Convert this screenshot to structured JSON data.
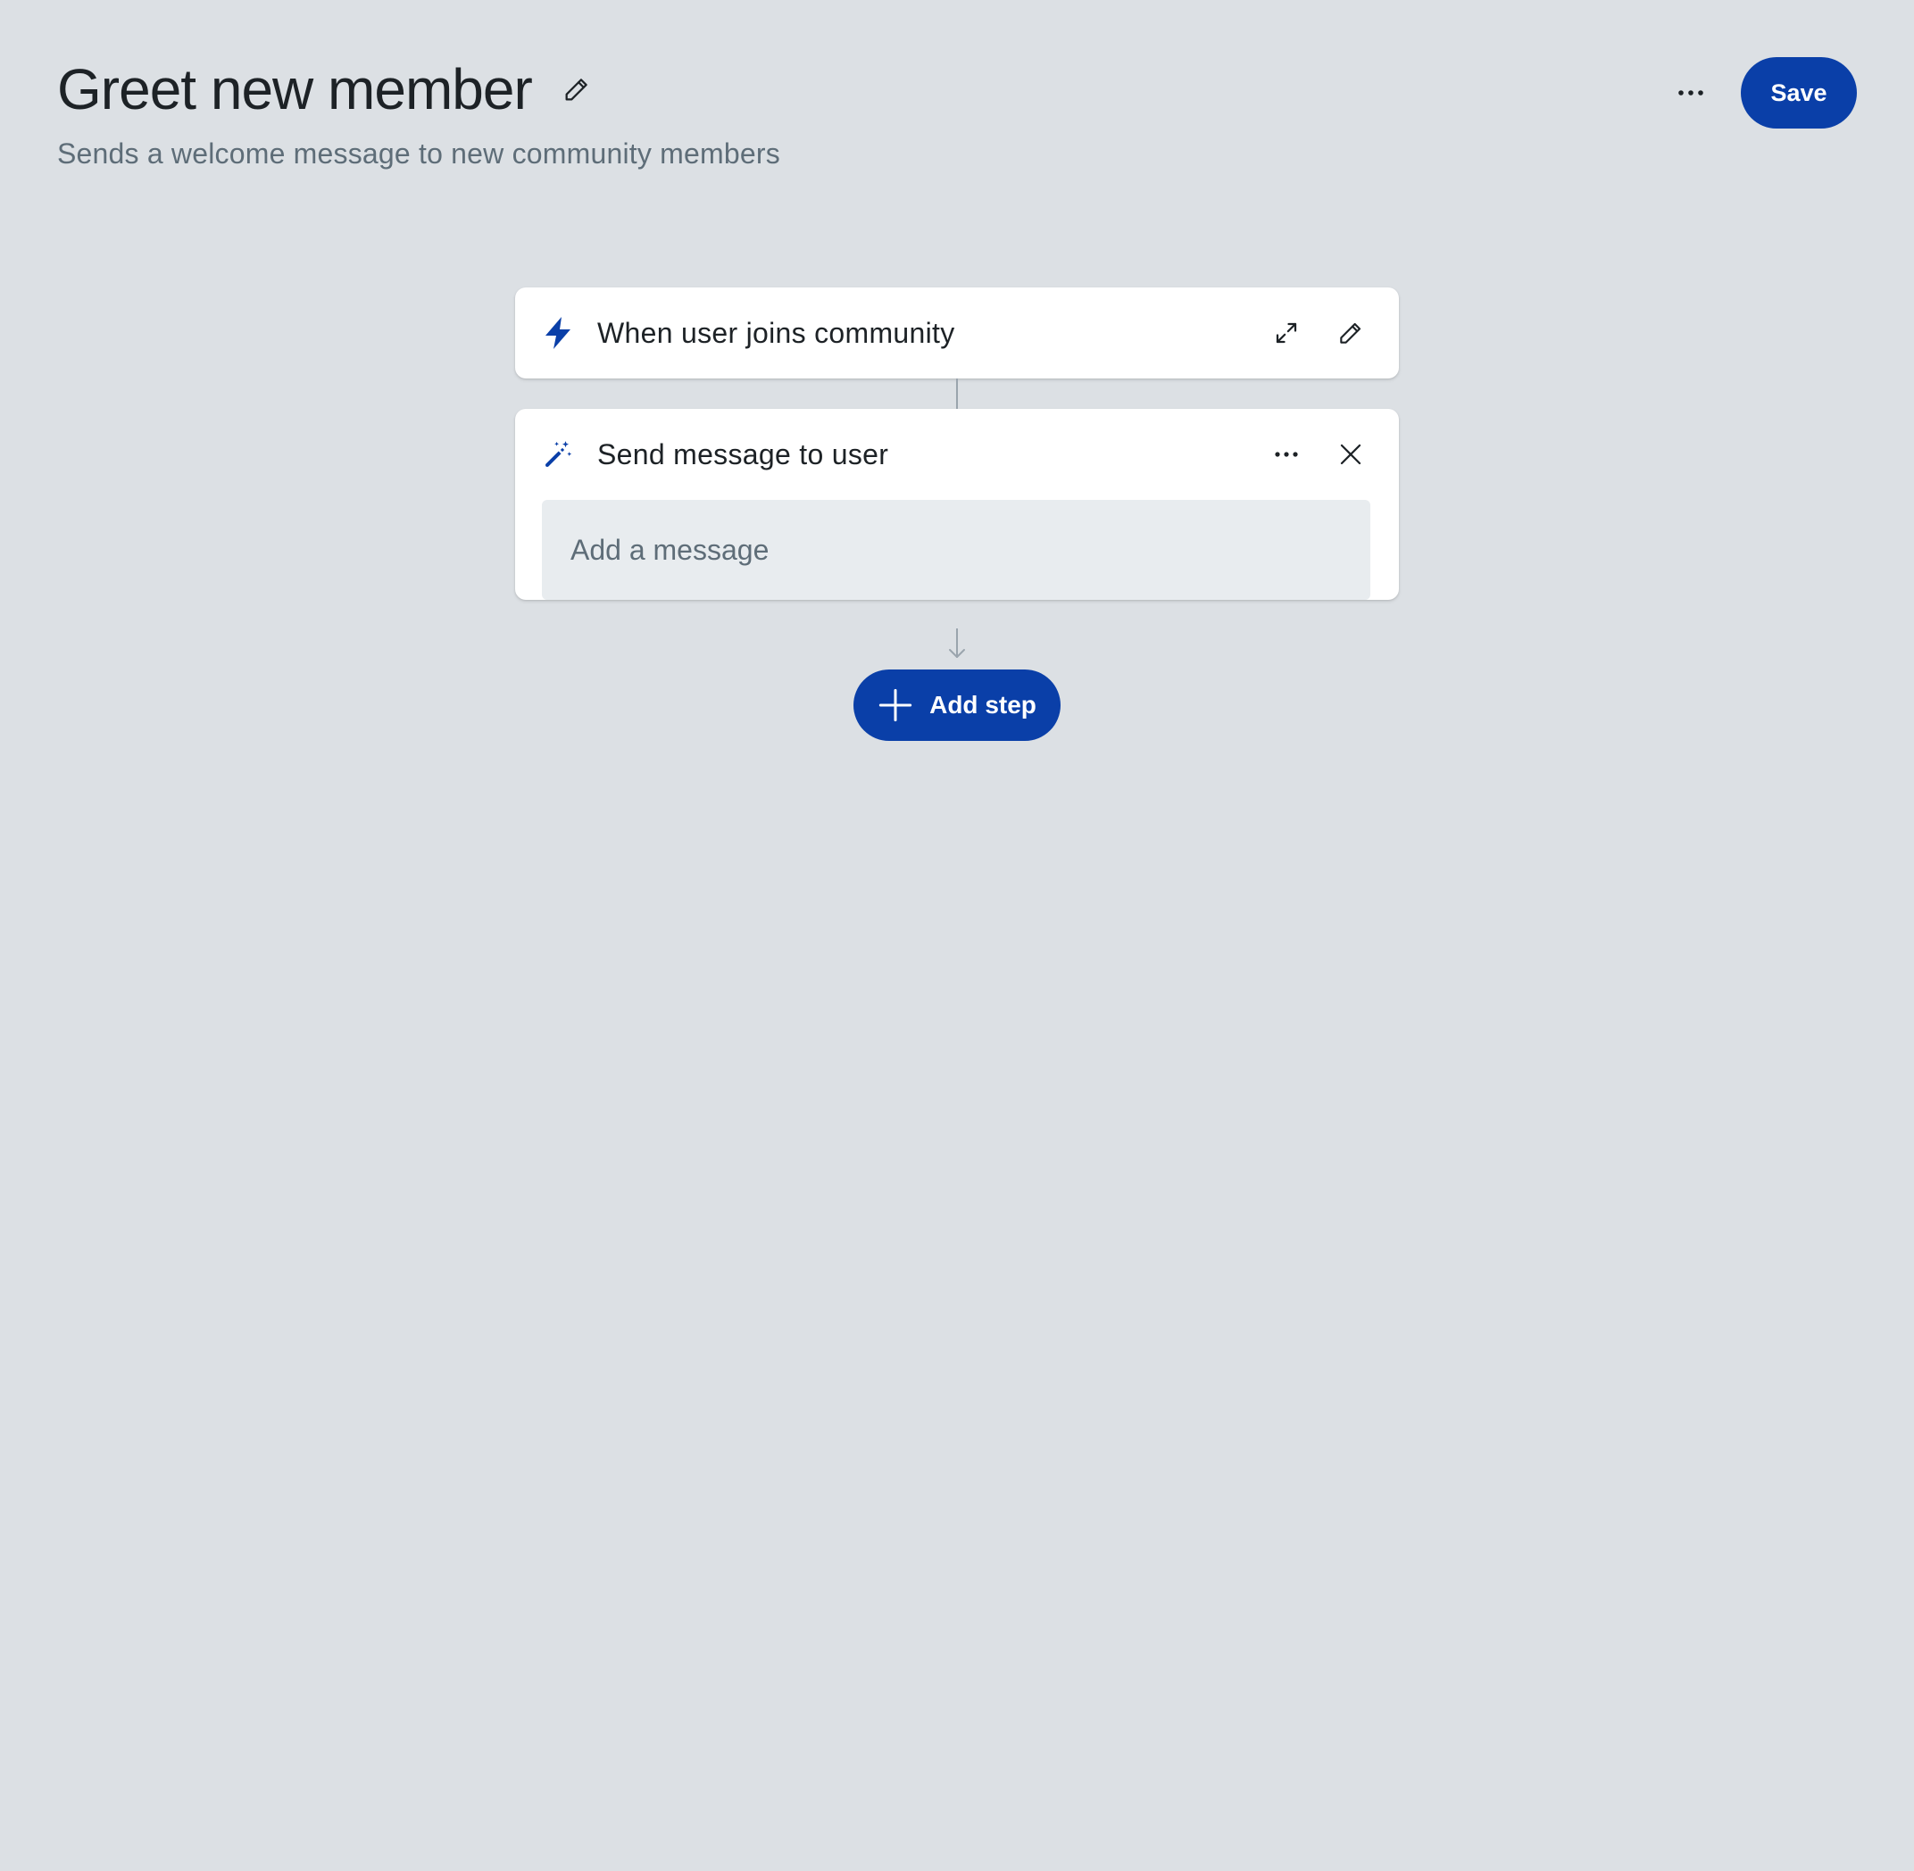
{
  "header": {
    "title": "Greet new member",
    "subtitle": "Sends a welcome message to new community members",
    "save_label": "Save"
  },
  "trigger_card": {
    "title": "When user joins community",
    "icon": "lightning-icon"
  },
  "action_card": {
    "title": "Send message to user",
    "icon": "magic-wand-icon",
    "message_placeholder": "Add a message",
    "message_value": ""
  },
  "add_step": {
    "label": "Add step"
  },
  "colors": {
    "background": "#dce0e4",
    "accent": "#0a3fa8",
    "card": "#ffffff",
    "input_bg": "#e8ecef",
    "muted_text": "#5e6d78"
  }
}
